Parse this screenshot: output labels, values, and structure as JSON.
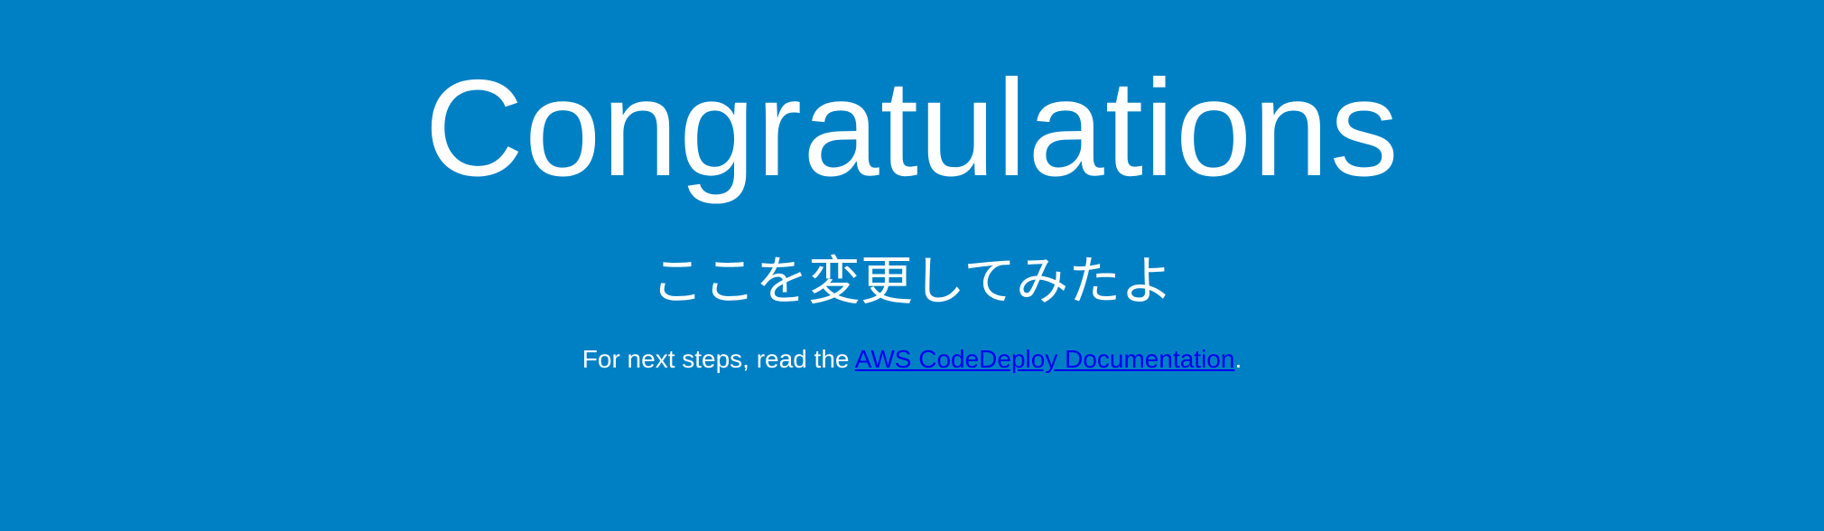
{
  "heading": "Congratulations",
  "subheading": "ここを変更してみたよ",
  "message": {
    "prefix": "For next steps, read the ",
    "link_text": "AWS CodeDeploy Documentation",
    "suffix": "."
  },
  "colors": {
    "background": "#0080c4",
    "text": "#ffffff",
    "link": "#0000ee"
  }
}
